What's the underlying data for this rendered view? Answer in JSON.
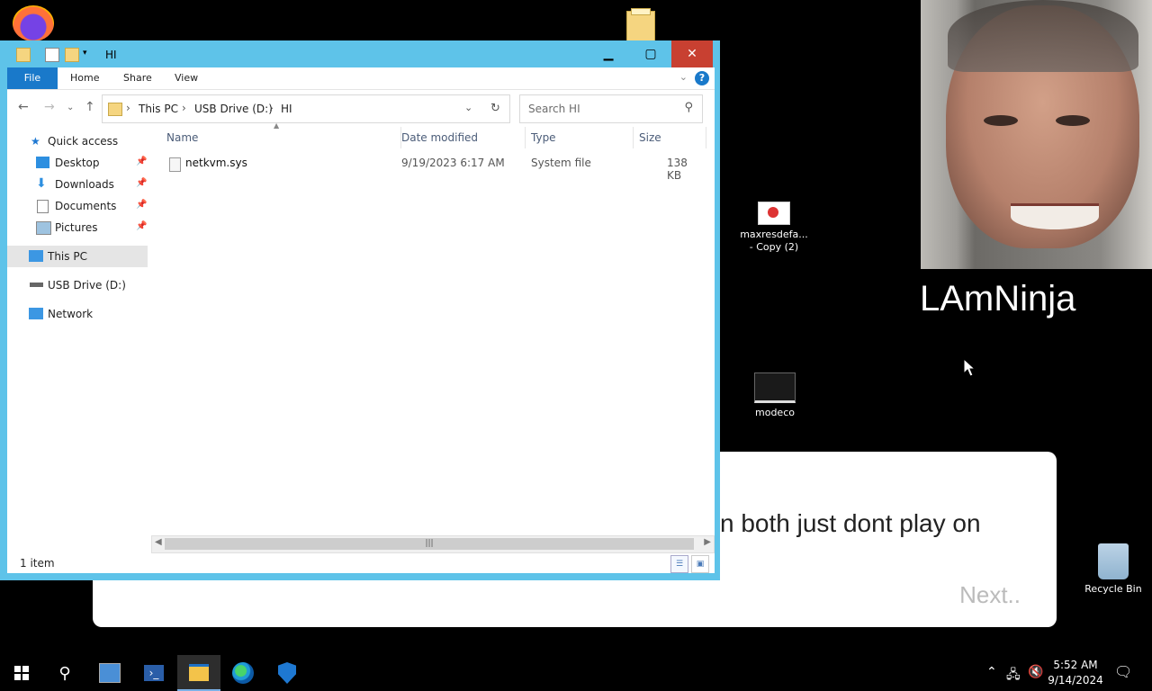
{
  "desktop": {
    "icons": [
      {
        "label": "maxresdefa...\n- Copy (2)",
        "icon": "image-file-icon"
      },
      {
        "label": "modeco",
        "icon": "image-file-icon"
      },
      {
        "label": "Recycle Bin",
        "icon": "recycle-bin-icon"
      }
    ],
    "overlay_name": "LAmNinja",
    "dialog": {
      "message": "n both just dont play on",
      "next_label": "Next.."
    }
  },
  "explorer": {
    "title": "HI",
    "ribbon_tabs": [
      "File",
      "Home",
      "Share",
      "View"
    ],
    "breadcrumb": [
      "This PC",
      "USB Drive (D:)",
      "HI"
    ],
    "search_placeholder": "Search HI",
    "sidebar": {
      "quick_access": "Quick access",
      "items": [
        {
          "label": "Desktop",
          "pinned": true
        },
        {
          "label": "Downloads",
          "pinned": true
        },
        {
          "label": "Documents",
          "pinned": true
        },
        {
          "label": "Pictures",
          "pinned": true
        }
      ],
      "this_pc": "This PC",
      "usb": "USB Drive (D:)",
      "network": "Network"
    },
    "columns": [
      "Name",
      "Date modified",
      "Type",
      "Size"
    ],
    "files": [
      {
        "name": "netkvm.sys",
        "modified": "9/19/2023 6:17 AM",
        "type": "System file",
        "size": "138 KB"
      }
    ],
    "status": "1 item"
  },
  "taskbar": {
    "time": "5:52 AM",
    "date": "9/14/2024"
  }
}
